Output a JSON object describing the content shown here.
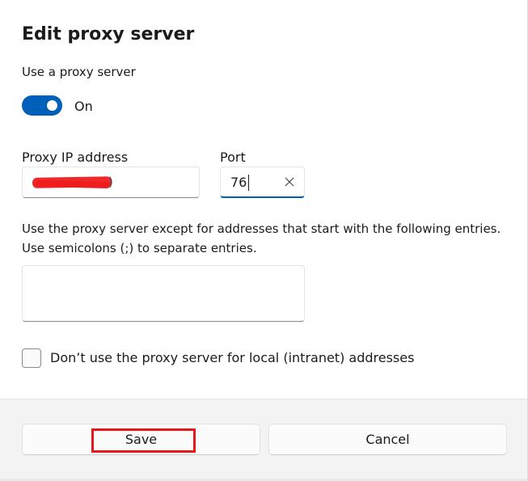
{
  "dialog": {
    "title": "Edit proxy server"
  },
  "proxy_toggle": {
    "label": "Use a proxy server",
    "state_text": "On",
    "checked": true
  },
  "ip_field": {
    "label": "Proxy IP address",
    "value_suffix": ")"
  },
  "port_field": {
    "label": "Port",
    "value": "76"
  },
  "exceptions": {
    "description_line1": "Use the proxy server except for addresses that start with the following entries.",
    "description_line2": "Use semicolons (;) to separate entries.",
    "value": ""
  },
  "local_checkbox": {
    "label": "Don’t use the proxy server for local (intranet) addresses",
    "checked": false
  },
  "footer": {
    "save_label": "Save",
    "cancel_label": "Cancel"
  },
  "colors": {
    "accent": "#005fb8",
    "highlight": "#e8171c",
    "redaction": "#ee1c1c"
  },
  "icons": {
    "clear": "clear-x-icon",
    "toggle_knob": "toggle-knob-icon"
  }
}
